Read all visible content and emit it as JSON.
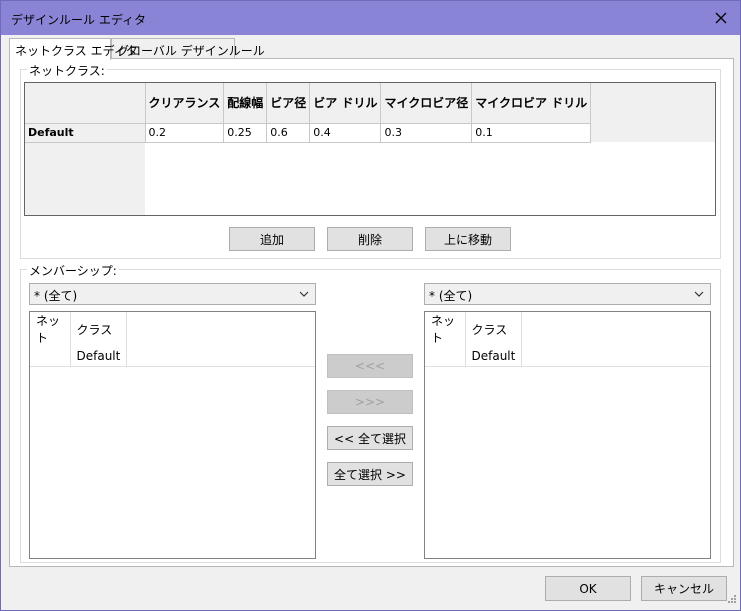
{
  "window": {
    "title": "デザインルール エディタ"
  },
  "tabs": [
    {
      "label": "ネットクラス エディタ",
      "active": true
    },
    {
      "label": "グローバル デザインルール",
      "active": false
    }
  ],
  "netclass": {
    "group_label": "ネットクラス:",
    "columns": [
      "クリアランス",
      "配線幅",
      "ビア径",
      "ビア ドリル",
      "マイクロビア径",
      "マイクロビア ドリル"
    ],
    "rows": [
      {
        "name": "Default",
        "values": [
          "0.2",
          "0.25",
          "0.6",
          "0.4",
          "0.3",
          "0.1"
        ]
      }
    ],
    "buttons": {
      "add": "追加",
      "delete": "削除",
      "move_up": "上に移動"
    }
  },
  "membership": {
    "group_label": "メンバーシップ:",
    "left_filter": "* (全て)",
    "right_filter": "* (全て)",
    "left_list": {
      "col_net": "ネット",
      "col_class": "クラス",
      "class_value": "Default"
    },
    "right_list": {
      "col_net": "ネット",
      "col_class": "クラス",
      "class_value": "Default"
    },
    "buttons": {
      "move_left": "<<<",
      "move_right": ">>>",
      "select_all_left": "<< 全て選択",
      "select_all_right": "全て選択 >>"
    }
  },
  "footer": {
    "ok": "OK",
    "cancel": "キャンセル"
  }
}
